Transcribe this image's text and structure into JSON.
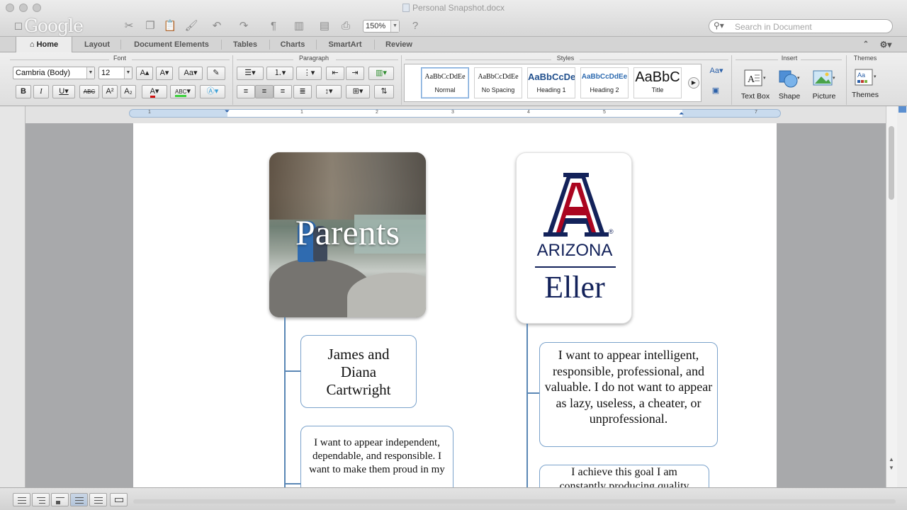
{
  "window": {
    "title": "Personal Snapshot.docx",
    "watermark": "Google"
  },
  "toolbar": {
    "zoom": "150%",
    "search_placeholder": "Search in Document"
  },
  "tabs": [
    {
      "label": "Home"
    },
    {
      "label": "Layout"
    },
    {
      "label": "Document Elements"
    },
    {
      "label": "Tables"
    },
    {
      "label": "Charts"
    },
    {
      "label": "SmartArt"
    },
    {
      "label": "Review"
    }
  ],
  "ribbon": {
    "groups": {
      "font": "Font",
      "paragraph": "Paragraph",
      "styles": "Styles",
      "insert": "Insert",
      "themes": "Themes"
    },
    "font_name": "Cambria (Body)",
    "font_size": "12",
    "styles": [
      {
        "preview": "AaBbCcDdEe",
        "name": "Normal"
      },
      {
        "preview": "AaBbCcDdEe",
        "name": "No Spacing"
      },
      {
        "preview": "AaBbCcDe",
        "name": "Heading 1"
      },
      {
        "preview": "AaBbCcDdEe",
        "name": "Heading 2"
      },
      {
        "preview": "AaBbC",
        "name": "Title"
      }
    ],
    "insert_items": [
      {
        "label": "Text Box"
      },
      {
        "label": "Shape"
      },
      {
        "label": "Picture"
      }
    ],
    "themes_label": "Themes"
  },
  "ruler": {
    "numbers": [
      "1",
      "1",
      "2",
      "3",
      "4",
      "5",
      "7"
    ]
  },
  "document": {
    "photo_label": "Parents",
    "logo": {
      "name": "ARIZONA",
      "sub": "Eller",
      "reg": "®"
    },
    "left_nodes": [
      {
        "text": "James and Diana Cartwright"
      },
      {
        "text": "I want to appear independent, dependable, and responsible. I want to make them proud in my"
      }
    ],
    "right_nodes": [
      {
        "text": "I want to appear intelligent, responsible, professional, and valuable. I do not want to appear as lazy, useless, a cheater, or unprofessional."
      },
      {
        "text": "I achieve this goal I am constantly producing quality"
      }
    ]
  },
  "colors": {
    "arizona_navy": "#13225a",
    "arizona_red": "#ab0520",
    "connector": "#5a87b5",
    "node_border": "#7aa2cb"
  }
}
